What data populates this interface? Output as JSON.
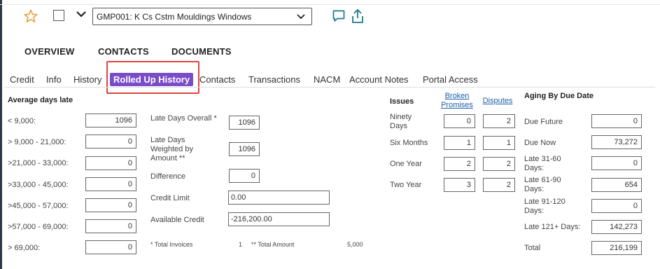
{
  "header": {
    "account_select_value": "GMP001: K Cs Cstm Mouldings Windows"
  },
  "main_tabs": [
    "OVERVIEW",
    "CONTACTS",
    "DOCUMENTS"
  ],
  "sub_tabs": [
    "Credit",
    "Info",
    "History",
    "Rolled Up History",
    "Contacts",
    "Transactions",
    "NACM",
    "Account Notes",
    "Portal Access"
  ],
  "active_sub_tab": "Rolled Up History",
  "avg_days_late": {
    "title": "Average days late",
    "rows": [
      {
        "label": "< 9,000:",
        "value": "1096"
      },
      {
        "label": "> 9,000 - 21,000:",
        "value": "0"
      },
      {
        "label": ">21,000 - 33,000:",
        "value": "0"
      },
      {
        "label": ">33,000 - 45,000:",
        "value": "0"
      },
      {
        "label": ">45,000 - 57,000:",
        "value": "0"
      },
      {
        "label": ">57,000 - 69,000:",
        "value": "0"
      },
      {
        "label": "> 69,000:",
        "value": "0"
      }
    ]
  },
  "late_summary": {
    "late_days_overall_label": "Late Days Overall *",
    "late_days_overall_value": "1096",
    "late_days_weighted_label": "Late Days Weighted by Amount **",
    "late_days_weighted_value": "1096",
    "difference_label": "Difference",
    "difference_value": "0",
    "credit_limit_label": "Credit Limit",
    "credit_limit_value": "0.00",
    "available_credit_label": "Available Credit",
    "available_credit_value": "-216,200.00"
  },
  "footnotes": {
    "total_invoices_label": "* Total Invoices",
    "total_invoices_value": "1",
    "total_amount_label": "** Total Amount",
    "total_amount_value": "5,000"
  },
  "issues": {
    "title": "Issues",
    "broken_promises_header": "Broken Promises",
    "disputes_header": "Disputes",
    "rows": [
      {
        "label": "Ninety Days",
        "broken": "0",
        "disputes": "2"
      },
      {
        "label": "Six Months",
        "broken": "1",
        "disputes": "1"
      },
      {
        "label": "One Year",
        "broken": "2",
        "disputes": "2"
      },
      {
        "label": "Two Year",
        "broken": "3",
        "disputes": "2"
      }
    ]
  },
  "aging": {
    "title": "Aging By Due Date",
    "rows": [
      {
        "label": "Due Future",
        "value": "0"
      },
      {
        "label": "Due Now",
        "value": "73,272"
      },
      {
        "label": "Late 31-60 Days:",
        "value": "0"
      },
      {
        "label": "Late 61-90 Days:",
        "value": "654"
      },
      {
        "label": "Late 91-120 Days:",
        "value": "0"
      },
      {
        "label": "Late 121+ Days:",
        "value": "142,273"
      },
      {
        "label": "Total",
        "value": "216,199"
      }
    ]
  },
  "colors": {
    "active_tab_bg": "#7a4cc9",
    "highlight_border": "#e0443e",
    "icon_orange": "#e8a23a",
    "icon_teal": "#1a7a8c"
  }
}
